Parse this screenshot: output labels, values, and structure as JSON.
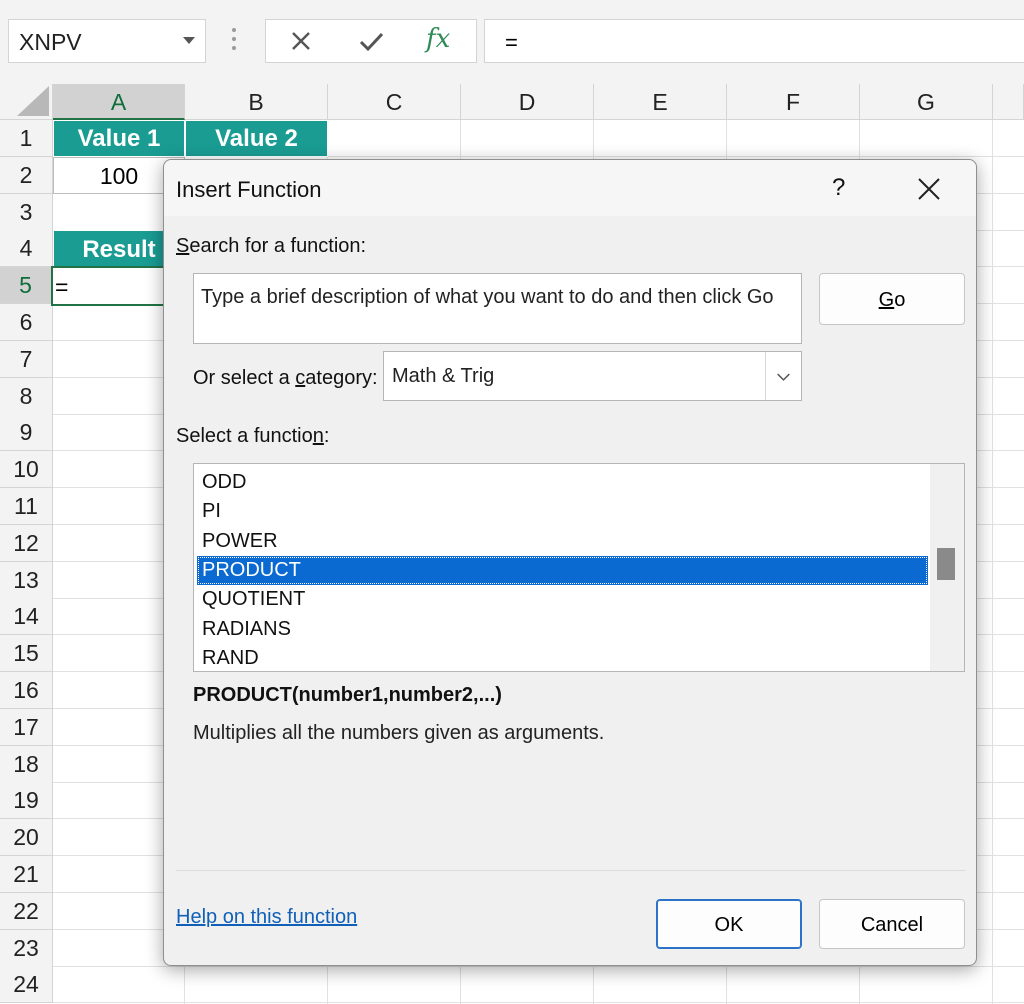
{
  "formula_bar": {
    "name_box": "XNPV",
    "formula": "="
  },
  "icons": {
    "cancel": "x-icon",
    "enter": "checkmark-icon",
    "function": "fx-icon",
    "fx_label": "fx"
  },
  "sheet": {
    "columns": [
      "A",
      "B",
      "C",
      "D",
      "E",
      "F",
      "G"
    ],
    "selected_column": "A",
    "rows": [
      "1",
      "2",
      "3",
      "4",
      "5",
      "6",
      "7",
      "8",
      "9",
      "10",
      "11",
      "12",
      "13",
      "14",
      "15",
      "16",
      "17",
      "18",
      "19",
      "20",
      "21",
      "22",
      "23",
      "24"
    ],
    "selected_row": "5",
    "cells": {
      "A1": "Value 1",
      "B1": "Value 2",
      "A2": "100",
      "A4": "Result",
      "A5": "="
    },
    "header_fill": "#1a9c93"
  },
  "dialog": {
    "title": "Insert Function",
    "help": "?",
    "search_label_pre": "S",
    "search_label_post": "earch for a function:",
    "search_value": "Type a brief description of what you want to do and then click Go",
    "go_pre": "",
    "go_key": "G",
    "go_post": "o",
    "category_label_pre": "Or select a ",
    "category_label_key": "c",
    "category_label_post": "ategory:",
    "category_value": "Math & Trig",
    "select_label_pre": "Select a functio",
    "select_label_key": "n",
    "select_label_post": ":",
    "functions": [
      "ODD",
      "PI",
      "POWER",
      "PRODUCT",
      "QUOTIENT",
      "RADIANS",
      "RAND"
    ],
    "selected_function": "PRODUCT",
    "scroll_position": 0.48,
    "syntax": "PRODUCT(number1,number2,...)",
    "description": "Multiplies all the numbers given as arguments.",
    "help_link": "Help on this function",
    "ok": "OK",
    "cancel": "Cancel",
    "accent": "#0a6ad2"
  }
}
